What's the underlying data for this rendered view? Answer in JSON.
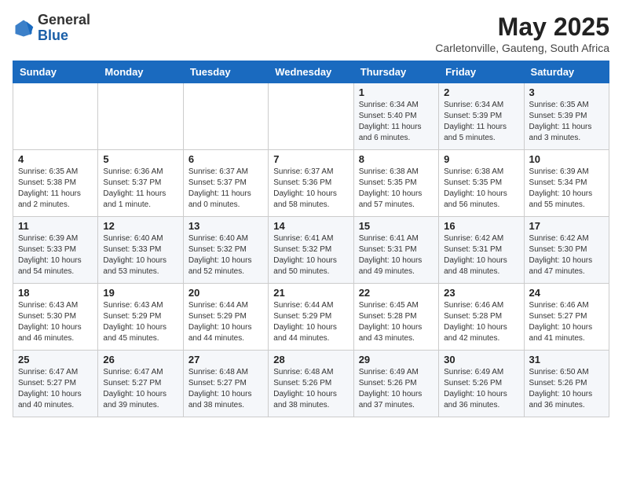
{
  "header": {
    "logo_general": "General",
    "logo_blue": "Blue",
    "month_title": "May 2025",
    "location": "Carletonville, Gauteng, South Africa"
  },
  "days_of_week": [
    "Sunday",
    "Monday",
    "Tuesday",
    "Wednesday",
    "Thursday",
    "Friday",
    "Saturday"
  ],
  "weeks": [
    [
      {
        "day": "",
        "info": ""
      },
      {
        "day": "",
        "info": ""
      },
      {
        "day": "",
        "info": ""
      },
      {
        "day": "",
        "info": ""
      },
      {
        "day": "1",
        "info": "Sunrise: 6:34 AM\nSunset: 5:40 PM\nDaylight: 11 hours\nand 6 minutes."
      },
      {
        "day": "2",
        "info": "Sunrise: 6:34 AM\nSunset: 5:39 PM\nDaylight: 11 hours\nand 5 minutes."
      },
      {
        "day": "3",
        "info": "Sunrise: 6:35 AM\nSunset: 5:39 PM\nDaylight: 11 hours\nand 3 minutes."
      }
    ],
    [
      {
        "day": "4",
        "info": "Sunrise: 6:35 AM\nSunset: 5:38 PM\nDaylight: 11 hours\nand 2 minutes."
      },
      {
        "day": "5",
        "info": "Sunrise: 6:36 AM\nSunset: 5:37 PM\nDaylight: 11 hours\nand 1 minute."
      },
      {
        "day": "6",
        "info": "Sunrise: 6:37 AM\nSunset: 5:37 PM\nDaylight: 11 hours\nand 0 minutes."
      },
      {
        "day": "7",
        "info": "Sunrise: 6:37 AM\nSunset: 5:36 PM\nDaylight: 10 hours\nand 58 minutes."
      },
      {
        "day": "8",
        "info": "Sunrise: 6:38 AM\nSunset: 5:35 PM\nDaylight: 10 hours\nand 57 minutes."
      },
      {
        "day": "9",
        "info": "Sunrise: 6:38 AM\nSunset: 5:35 PM\nDaylight: 10 hours\nand 56 minutes."
      },
      {
        "day": "10",
        "info": "Sunrise: 6:39 AM\nSunset: 5:34 PM\nDaylight: 10 hours\nand 55 minutes."
      }
    ],
    [
      {
        "day": "11",
        "info": "Sunrise: 6:39 AM\nSunset: 5:33 PM\nDaylight: 10 hours\nand 54 minutes."
      },
      {
        "day": "12",
        "info": "Sunrise: 6:40 AM\nSunset: 5:33 PM\nDaylight: 10 hours\nand 53 minutes."
      },
      {
        "day": "13",
        "info": "Sunrise: 6:40 AM\nSunset: 5:32 PM\nDaylight: 10 hours\nand 52 minutes."
      },
      {
        "day": "14",
        "info": "Sunrise: 6:41 AM\nSunset: 5:32 PM\nDaylight: 10 hours\nand 50 minutes."
      },
      {
        "day": "15",
        "info": "Sunrise: 6:41 AM\nSunset: 5:31 PM\nDaylight: 10 hours\nand 49 minutes."
      },
      {
        "day": "16",
        "info": "Sunrise: 6:42 AM\nSunset: 5:31 PM\nDaylight: 10 hours\nand 48 minutes."
      },
      {
        "day": "17",
        "info": "Sunrise: 6:42 AM\nSunset: 5:30 PM\nDaylight: 10 hours\nand 47 minutes."
      }
    ],
    [
      {
        "day": "18",
        "info": "Sunrise: 6:43 AM\nSunset: 5:30 PM\nDaylight: 10 hours\nand 46 minutes."
      },
      {
        "day": "19",
        "info": "Sunrise: 6:43 AM\nSunset: 5:29 PM\nDaylight: 10 hours\nand 45 minutes."
      },
      {
        "day": "20",
        "info": "Sunrise: 6:44 AM\nSunset: 5:29 PM\nDaylight: 10 hours\nand 44 minutes."
      },
      {
        "day": "21",
        "info": "Sunrise: 6:44 AM\nSunset: 5:29 PM\nDaylight: 10 hours\nand 44 minutes."
      },
      {
        "day": "22",
        "info": "Sunrise: 6:45 AM\nSunset: 5:28 PM\nDaylight: 10 hours\nand 43 minutes."
      },
      {
        "day": "23",
        "info": "Sunrise: 6:46 AM\nSunset: 5:28 PM\nDaylight: 10 hours\nand 42 minutes."
      },
      {
        "day": "24",
        "info": "Sunrise: 6:46 AM\nSunset: 5:27 PM\nDaylight: 10 hours\nand 41 minutes."
      }
    ],
    [
      {
        "day": "25",
        "info": "Sunrise: 6:47 AM\nSunset: 5:27 PM\nDaylight: 10 hours\nand 40 minutes."
      },
      {
        "day": "26",
        "info": "Sunrise: 6:47 AM\nSunset: 5:27 PM\nDaylight: 10 hours\nand 39 minutes."
      },
      {
        "day": "27",
        "info": "Sunrise: 6:48 AM\nSunset: 5:27 PM\nDaylight: 10 hours\nand 38 minutes."
      },
      {
        "day": "28",
        "info": "Sunrise: 6:48 AM\nSunset: 5:26 PM\nDaylight: 10 hours\nand 38 minutes."
      },
      {
        "day": "29",
        "info": "Sunrise: 6:49 AM\nSunset: 5:26 PM\nDaylight: 10 hours\nand 37 minutes."
      },
      {
        "day": "30",
        "info": "Sunrise: 6:49 AM\nSunset: 5:26 PM\nDaylight: 10 hours\nand 36 minutes."
      },
      {
        "day": "31",
        "info": "Sunrise: 6:50 AM\nSunset: 5:26 PM\nDaylight: 10 hours\nand 36 minutes."
      }
    ]
  ]
}
